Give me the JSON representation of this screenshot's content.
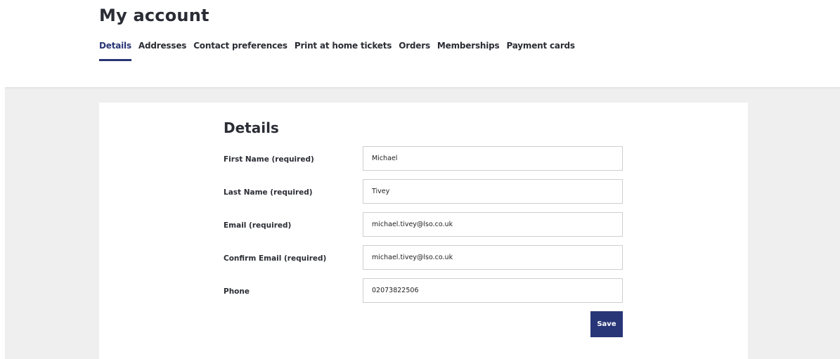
{
  "header": {
    "title": "My account",
    "tabs": [
      {
        "label": "Details",
        "active": true
      },
      {
        "label": "Addresses",
        "active": false
      },
      {
        "label": "Contact preferences",
        "active": false
      },
      {
        "label": "Print at home tickets",
        "active": false
      },
      {
        "label": "Orders",
        "active": false
      },
      {
        "label": "Memberships",
        "active": false
      },
      {
        "label": "Payment cards",
        "active": false
      }
    ]
  },
  "form": {
    "title": "Details",
    "fields": [
      {
        "label": "First Name (required)",
        "value": "Michael"
      },
      {
        "label": "Last Name (required)",
        "value": "Tivey"
      },
      {
        "label": "Email (required)",
        "value": "michael.tivey@lso.co.uk"
      },
      {
        "label": "Confirm Email (required)",
        "value": "michael.tivey@lso.co.uk"
      },
      {
        "label": "Phone",
        "value": "02073822506"
      }
    ],
    "save_label": "Save"
  },
  "colors": {
    "accent": "#283577",
    "text": "#2b2d35",
    "background_gray": "#efefef"
  }
}
